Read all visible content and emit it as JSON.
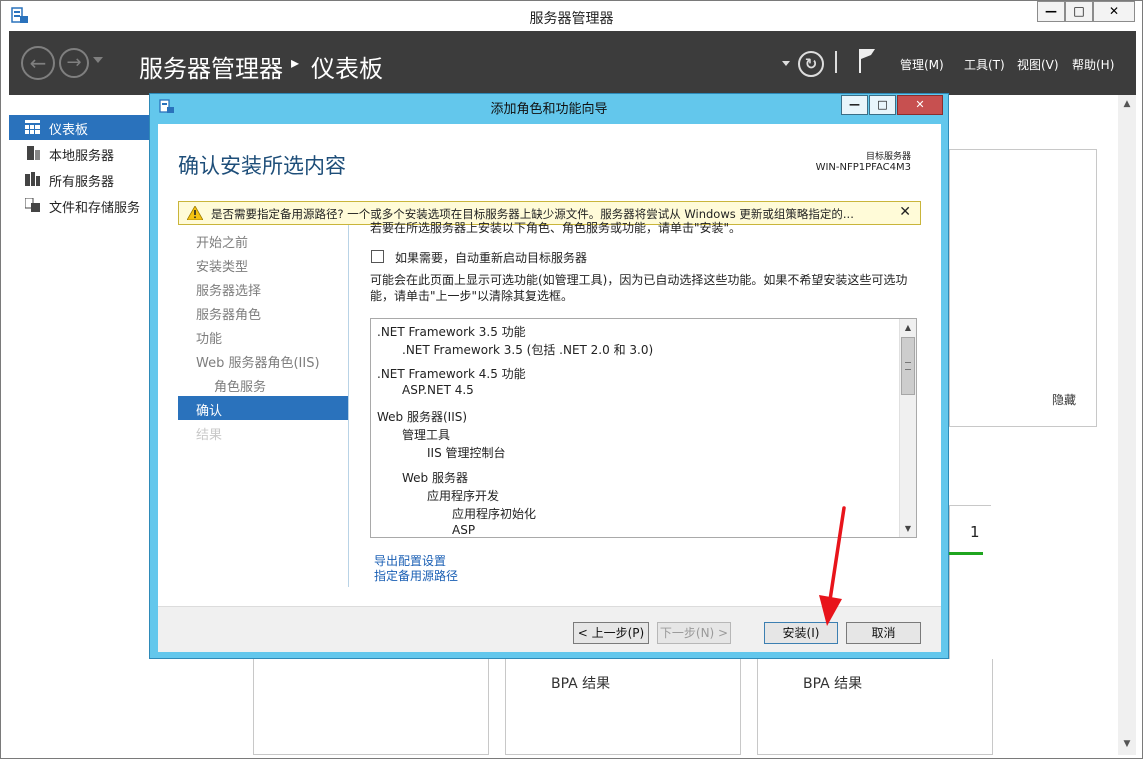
{
  "window": {
    "title": "服务器管理器",
    "controls": {
      "min": "—",
      "max": "□",
      "close": "✕"
    }
  },
  "header": {
    "breadcrumb_root": "服务器管理器",
    "breadcrumb_sep": "▸",
    "breadcrumb_current": "仪表板",
    "refresh_icon": "↻",
    "menus": [
      "管理(M)",
      "工具(T)",
      "视图(V)",
      "帮助(H)"
    ]
  },
  "sidebar": {
    "items": [
      {
        "label": "仪表板",
        "icon": "dashboard-icon",
        "active": true
      },
      {
        "label": "本地服务器",
        "icon": "server-icon",
        "active": false
      },
      {
        "label": "所有服务器",
        "icon": "servers-icon",
        "active": false
      },
      {
        "label": "文件和存储服务",
        "icon": "file-storage-icon",
        "active": false
      }
    ]
  },
  "background_tiles": {
    "hide_label": "隐藏",
    "count": "1",
    "bpa_1": "BPA 结果",
    "bpa_2": "BPA 结果"
  },
  "dialog": {
    "title": "添加角色和功能向导",
    "controls": {
      "min": "—",
      "max": "□",
      "close": "✕"
    },
    "page_title": "确认安装所选内容",
    "dest_label": "目标服务器",
    "dest_value": "WIN-NFP1PFAC4M3",
    "warning": {
      "text": "是否需要指定备用源路径? 一个或多个安装选项在目标服务器上缺少源文件。服务器将尝试从 Windows 更新或组策略指定的...",
      "close": "✕"
    },
    "steps": [
      {
        "label": "开始之前",
        "state": "normal",
        "indent": false
      },
      {
        "label": "安装类型",
        "state": "normal",
        "indent": false
      },
      {
        "label": "服务器选择",
        "state": "normal",
        "indent": false
      },
      {
        "label": "服务器角色",
        "state": "normal",
        "indent": false
      },
      {
        "label": "功能",
        "state": "normal",
        "indent": false
      },
      {
        "label": "Web 服务器角色(IIS)",
        "state": "normal",
        "indent": false
      },
      {
        "label": "角色服务",
        "state": "normal",
        "indent": true
      },
      {
        "label": "确认",
        "state": "active",
        "indent": false
      },
      {
        "label": "结果",
        "state": "disabled",
        "indent": false
      }
    ],
    "intro": "若要在所选服务器上安装以下角色、角色服务或功能，请单击\"安装\"。",
    "restart_checkbox": {
      "label": "如果需要，自动重新启动目标服务器",
      "checked": false
    },
    "optional_note_1": "可能会在此页面上显示可选功能(如管理工具)，因为已自动选择这些功能。如果不希望安装这些可选功",
    "optional_note_2": "能，请单击\"上一步\"以清除其复选框。",
    "features": [
      {
        "text": ".NET Framework 3.5 功能",
        "level": 0
      },
      {
        "text": ".NET Framework 3.5 (包括 .NET 2.0 和 3.0)",
        "level": 1
      },
      {
        "text": ".NET Framework 4.5 功能",
        "level": 0
      },
      {
        "text": "ASP.NET 4.5",
        "level": 1
      },
      {
        "text": "Web 服务器(IIS)",
        "level": 0
      },
      {
        "text": "管理工具",
        "level": 1
      },
      {
        "text": "IIS 管理控制台",
        "level": 2
      },
      {
        "text": "Web 服务器",
        "level": 1
      },
      {
        "text": "应用程序开发",
        "level": 2
      },
      {
        "text": "应用程序初始化",
        "level": 3
      },
      {
        "text": "ASP",
        "level": 3
      }
    ],
    "links": {
      "export": "导出配置设置",
      "alt_source": "指定备用源路径"
    },
    "buttons": {
      "previous": "< 上一步(P)",
      "next": "下一步(N) >",
      "install": "安装(I)",
      "cancel": "取消"
    }
  },
  "colors": {
    "header_bg": "#3c3c3c",
    "accent": "#2a72bc",
    "dialog_frame": "#63c7ec",
    "annotation_arrow": "#e8141b"
  }
}
